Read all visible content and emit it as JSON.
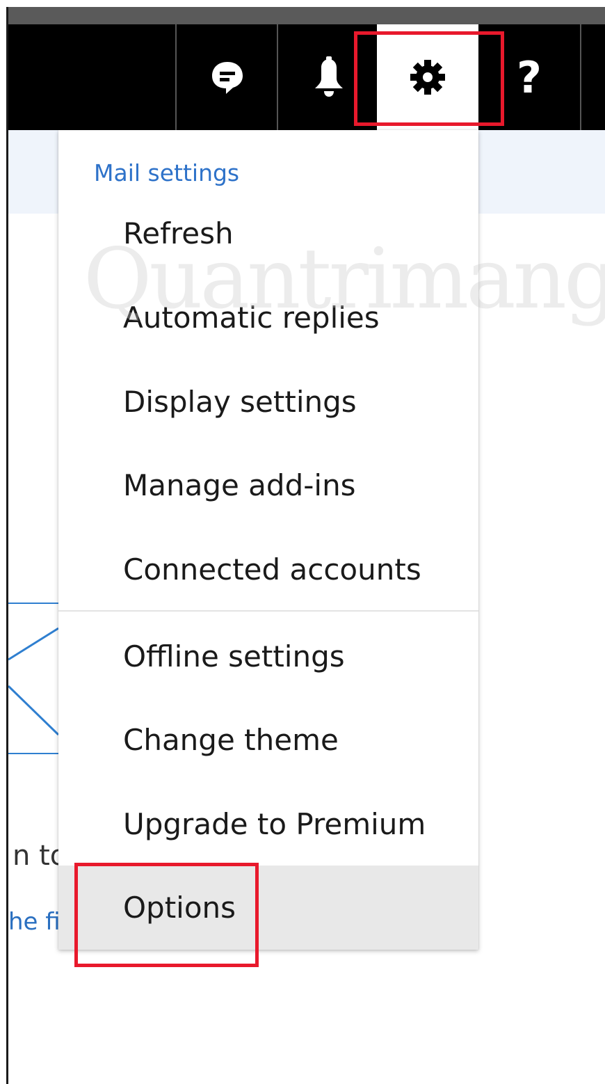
{
  "topbar": {
    "buttons": [
      {
        "name": "feedback",
        "icon": "chat-bubble-icon"
      },
      {
        "name": "notifications",
        "icon": "bell-icon"
      },
      {
        "name": "settings",
        "icon": "gear-icon",
        "active": true
      },
      {
        "name": "help",
        "icon": "question-mark-icon",
        "glyph": "?"
      }
    ]
  },
  "menu": {
    "heading": "Mail settings",
    "items": [
      {
        "label": "Refresh"
      },
      {
        "label": "Automatic replies"
      },
      {
        "label": "Display settings"
      },
      {
        "label": "Manage add-ins"
      },
      {
        "label": "Connected accounts"
      },
      {
        "label": "Offline settings"
      },
      {
        "label": "Change theme"
      },
      {
        "label": "Upgrade to Premium"
      },
      {
        "label": "Options",
        "highlighted": true
      }
    ]
  },
  "background": {
    "fragment_to": "n to",
    "fragment_fi": "he fi"
  },
  "watermark": "Quantrimang",
  "colors": {
    "topbar": "#000000",
    "accent_link": "#2e72c9",
    "highlight_box": "#e8192c",
    "hover_row": "#e8e8e8"
  }
}
